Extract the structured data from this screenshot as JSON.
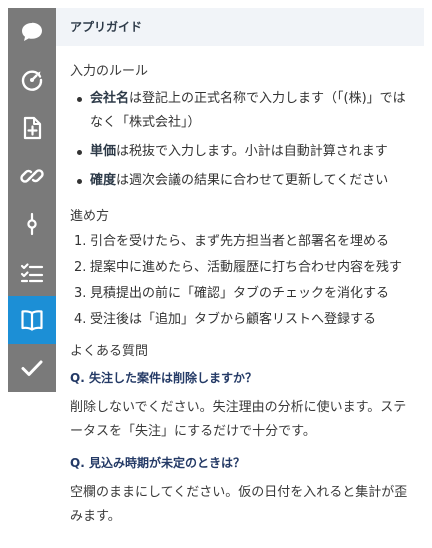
{
  "sidebar": {
    "items": [
      {
        "icon": "chat-bubble-icon",
        "active": false
      },
      {
        "icon": "speed-gauge-icon",
        "active": false
      },
      {
        "icon": "add-document-icon",
        "active": false
      },
      {
        "icon": "link-icon",
        "active": false
      },
      {
        "icon": "commit-icon",
        "active": false
      },
      {
        "icon": "checklist-icon",
        "active": false
      },
      {
        "icon": "book-icon",
        "active": true
      },
      {
        "icon": "check-icon",
        "active": false
      }
    ],
    "active_color": "#1c8fd6",
    "background_color": "#7a7a7a"
  },
  "panel": {
    "title": "アプリガイド",
    "rules_title": "入力のルール",
    "rules": [
      {
        "term": "会社名",
        "text": "は登記上の正式名称で入力します（「(株)」ではなく「株式会社」）"
      },
      {
        "term": "単価",
        "text": "は税抜で入力します。小計は自動計算されます"
      },
      {
        "term": "確度",
        "text": "は週次会議の結果に合わせて更新してください"
      }
    ],
    "steps_title": "進め方",
    "steps": [
      {
        "num": "1.",
        "text": "引合を受けたら、まず先方担当者と部署名を埋める"
      },
      {
        "num": "2.",
        "text": "提案中に進めたら、活動履歴に打ち合わせ内容を残す"
      },
      {
        "num": "3.",
        "text": "見積提出の前に「確認」タブのチェックを消化する"
      },
      {
        "num": "4.",
        "text": "受注後は「追加」タブから顧客リストへ登録する"
      }
    ],
    "faq_title": "よくある質問",
    "faq": [
      {
        "q": "Q. 失注した案件は削除しますか？",
        "a": "削除しないでください。失注理由の分析に使います。ステータスを「失注」にするだけで十分です。"
      },
      {
        "q": "Q. 見込み時期が未定のときは？",
        "a": "空欄のままにしてください。仮の日付を入れると集計が歪みます。"
      }
    ]
  }
}
